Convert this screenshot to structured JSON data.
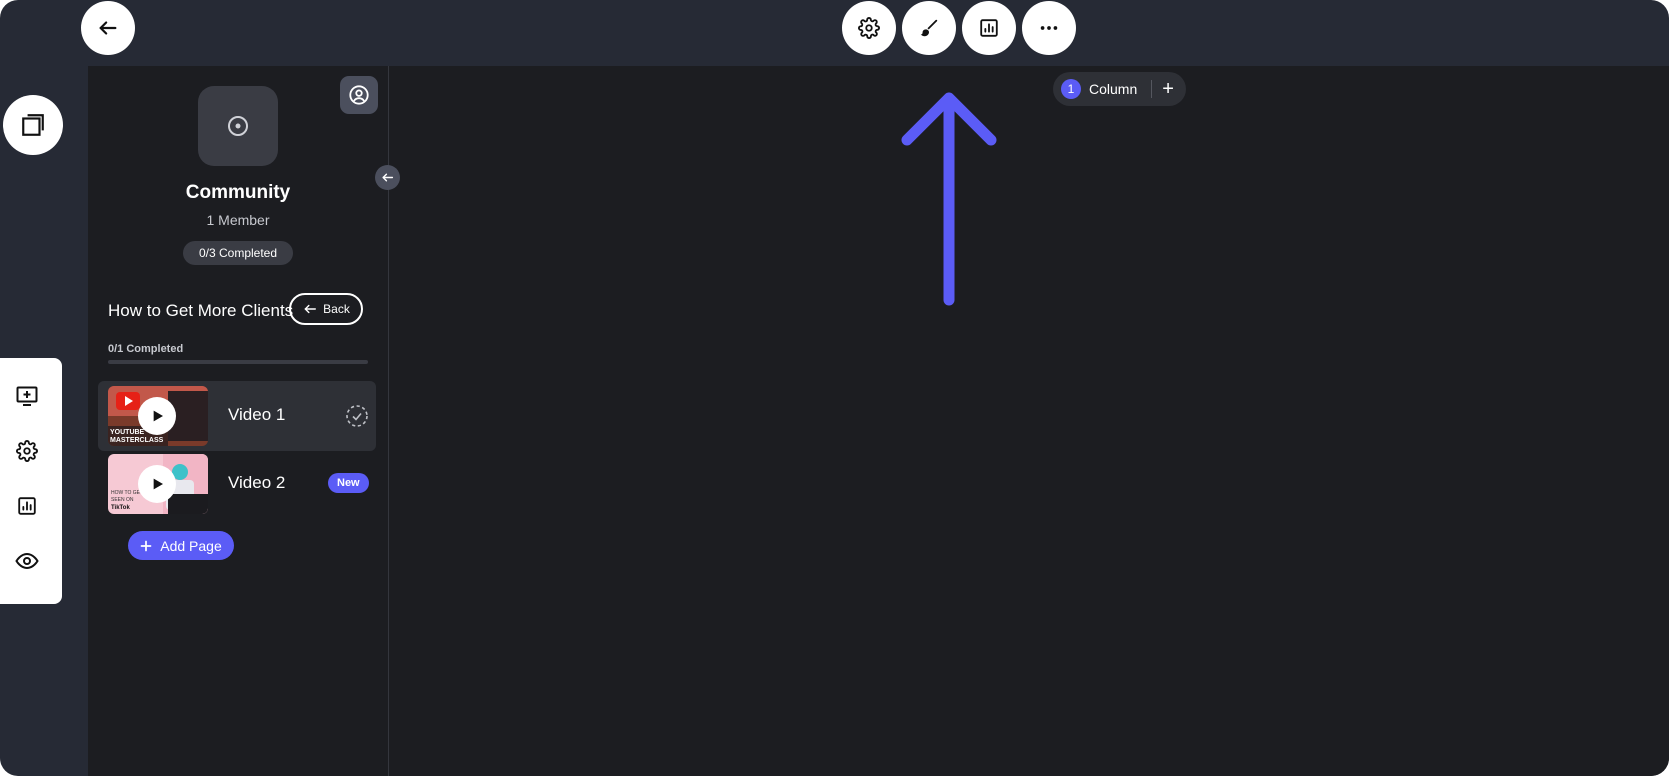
{
  "colors": {
    "app_bg": "#262a35",
    "canvas_bg": "#1c1d21",
    "accent": "#5b5cf6",
    "white": "#ffffff"
  },
  "toolbar": {
    "back_icon": "arrow-left-icon",
    "center_icons": [
      "gear-icon",
      "brush-icon",
      "chart-icon",
      "more-icon"
    ]
  },
  "left_rail": {
    "top_icon": "pages-icon",
    "icons": [
      "add-screen-icon",
      "gear-icon",
      "chart-icon",
      "eye-icon"
    ]
  },
  "sidebar": {
    "community_title": "Community",
    "members": "1 Member",
    "completed_badge": "0/3 Completed",
    "section": {
      "title": "How to Get More Clients",
      "back_label": "Back",
      "progress_label": "0/1 Completed",
      "progress_fraction": 0
    },
    "videos": [
      {
        "label": "Video 1",
        "status": "incomplete-check-icon"
      },
      {
        "label": "Video 2",
        "badge": "New"
      }
    ],
    "add_page_label": "Add Page"
  },
  "canvas": {
    "column_count": "1",
    "column_label": "Column",
    "add_symbol": "+"
  }
}
